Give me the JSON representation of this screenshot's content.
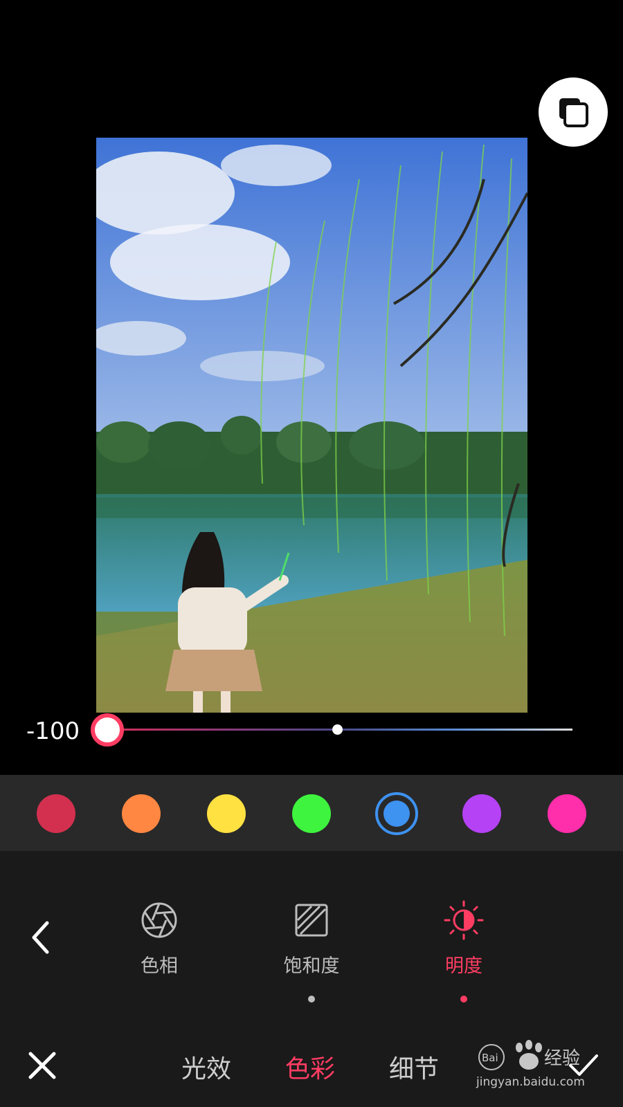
{
  "editor": {
    "slider_value": "-100",
    "slider_level": -100
  },
  "colors": {
    "swatches": [
      {
        "name": "red",
        "hex": "#d3304f"
      },
      {
        "name": "orange",
        "hex": "#ff8742"
      },
      {
        "name": "yellow",
        "hex": "#ffe142"
      },
      {
        "name": "green",
        "hex": "#3ef43e"
      },
      {
        "name": "blue",
        "hex": "#3e92f0",
        "selected": true
      },
      {
        "name": "purple",
        "hex": "#b542f5"
      },
      {
        "name": "pink",
        "hex": "#ff2eab"
      }
    ],
    "accent": "#ff3d63"
  },
  "tools": {
    "hue_label": "色相",
    "saturation_label": "饱和度",
    "brightness_label": "明度"
  },
  "bottom_nav": {
    "light_label": "光效",
    "color_label": "色彩",
    "detail_label": "细节"
  },
  "icons": {
    "compare": "compare-layers-icon",
    "back": "chevron-left-icon",
    "hue": "aperture-icon",
    "saturation": "hatched-square-icon",
    "brightness": "sun-half-icon",
    "close": "close-icon",
    "confirm": "check-icon"
  },
  "watermark": {
    "text": "Bai du 经验",
    "url_text": "jingyan.baidu.com"
  }
}
